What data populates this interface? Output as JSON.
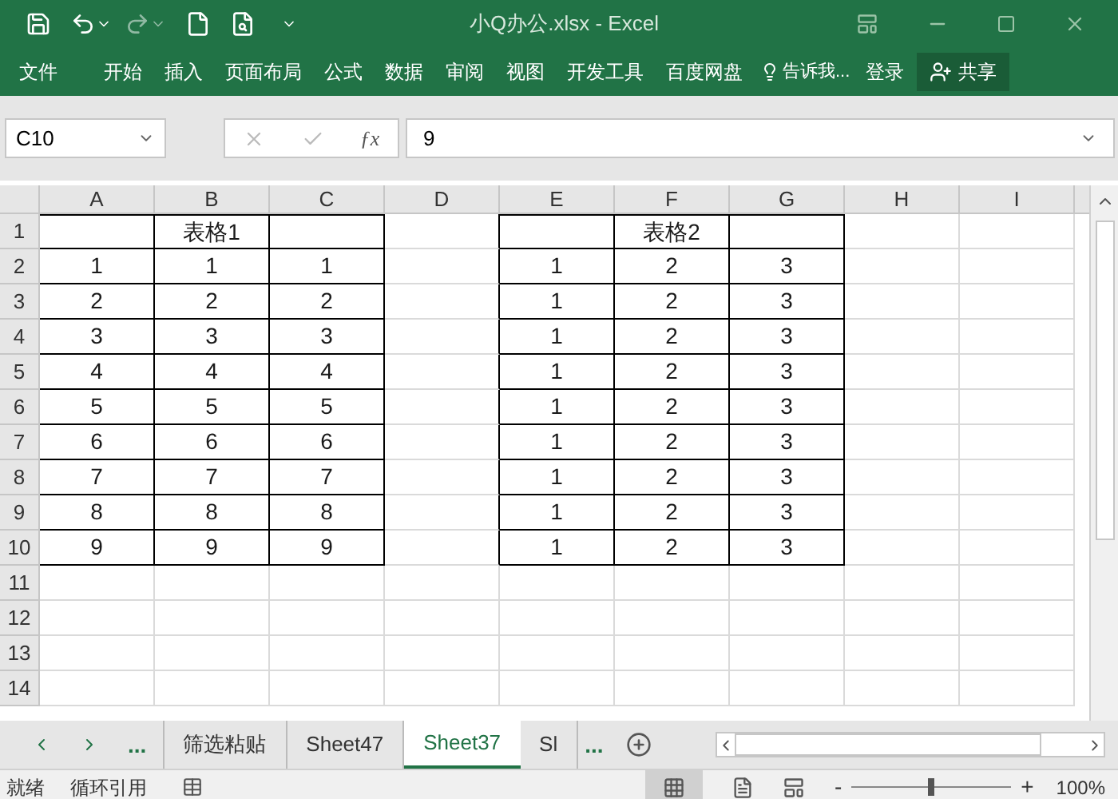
{
  "window": {
    "title": "小Q办公.xlsx - Excel"
  },
  "ribbon_tabs": [
    "文件",
    "开始",
    "插入",
    "页面布局",
    "公式",
    "数据",
    "审阅",
    "视图",
    "开发工具",
    "百度网盘"
  ],
  "tell_me": "告诉我...",
  "sign_in": "登录",
  "share": "共享",
  "name_box": "C10",
  "function_button": "ƒx",
  "formula": "9",
  "columns": [
    "A",
    "B",
    "C",
    "D",
    "E",
    "F",
    "G",
    "H",
    "I"
  ],
  "row_numbers": [
    "1",
    "2",
    "3",
    "4",
    "5",
    "6",
    "7",
    "8",
    "9",
    "10",
    "11",
    "12",
    "13",
    "14"
  ],
  "tables": [
    {
      "title": "表格1",
      "rows": [
        [
          "1",
          "1",
          "1"
        ],
        [
          "2",
          "2",
          "2"
        ],
        [
          "3",
          "3",
          "3"
        ],
        [
          "4",
          "4",
          "4"
        ],
        [
          "5",
          "5",
          "5"
        ],
        [
          "6",
          "6",
          "6"
        ],
        [
          "7",
          "7",
          "7"
        ],
        [
          "8",
          "8",
          "8"
        ],
        [
          "9",
          "9",
          "9"
        ]
      ]
    },
    {
      "title": "表格2",
      "rows": [
        [
          "1",
          "2",
          "3"
        ],
        [
          "1",
          "2",
          "3"
        ],
        [
          "1",
          "2",
          "3"
        ],
        [
          "1",
          "2",
          "3"
        ],
        [
          "1",
          "2",
          "3"
        ],
        [
          "1",
          "2",
          "3"
        ],
        [
          "1",
          "2",
          "3"
        ],
        [
          "1",
          "2",
          "3"
        ],
        [
          "1",
          "2",
          "3"
        ]
      ]
    }
  ],
  "sheet_nav_more": "...",
  "sheet_tabs": [
    {
      "label": "筛选粘贴",
      "selected": false
    },
    {
      "label": "Sheet47",
      "selected": false
    },
    {
      "label": "Sheet37",
      "selected": true
    },
    {
      "label": "Sl",
      "selected": false
    }
  ],
  "sheet_tabs_more": "...",
  "status": {
    "ready": "就绪",
    "circular": "循环引用",
    "zoom_minus": "-",
    "zoom_plus": "+",
    "zoom": {
      "level": 0.5
    },
    "zoom_text": "100%"
  }
}
